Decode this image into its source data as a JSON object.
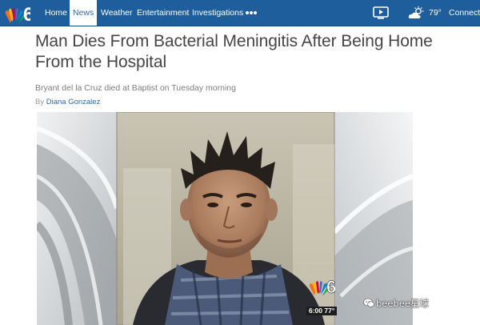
{
  "nav": {
    "items": [
      {
        "label": "Home",
        "active": false
      },
      {
        "label": "News",
        "active": true
      },
      {
        "label": "Weather",
        "active": false
      },
      {
        "label": "Entertainment",
        "active": false
      },
      {
        "label": "Investigations",
        "active": false
      }
    ],
    "more_icon": "more-dots-icon",
    "tv_icon": "tv-play-icon",
    "weather_icon": "partly-cloudy-icon",
    "temperature": "79°",
    "connect_label": "Connect",
    "logo_text": "6"
  },
  "article": {
    "headline": "Man Dies From Bacterial Meningitis After Being Home From the Hospital",
    "subhead": "Bryant del la Cruz died at Baptist on Tuesday morning",
    "byline_prefix": "By",
    "author": "Diana Gonzalez"
  },
  "photo": {
    "bug_logo_text": "6",
    "bug_text": "6:00 77°",
    "watermark_text": "beebee星球"
  },
  "colors": {
    "nav_bg": "#1f5e9c",
    "accent": "#2b6bb0",
    "headline": "#454545"
  }
}
